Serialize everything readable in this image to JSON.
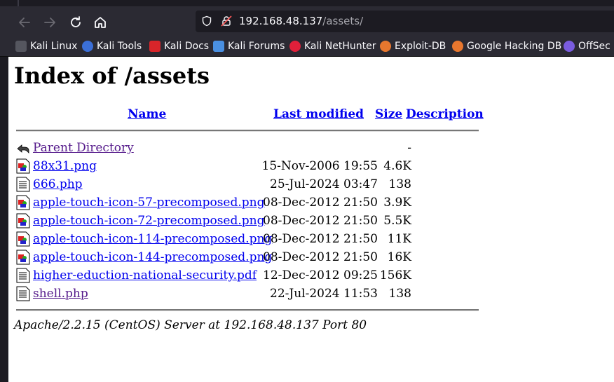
{
  "browser": {
    "url_host": "192.168.48.137",
    "url_path": "/assets/",
    "bookmarks": [
      {
        "label": "Kali Linux",
        "icon": "kali-dragon-icon",
        "color": "#dddddd"
      },
      {
        "label": "Kali Tools",
        "icon": "kali-tools-icon",
        "color": "#3b6fd8"
      },
      {
        "label": "Kali Docs",
        "icon": "kali-docs-icon",
        "color": "#d9252a"
      },
      {
        "label": "Kali Forums",
        "icon": "kali-forums-icon",
        "color": "#4a90e2"
      },
      {
        "label": "Kali NetHunter",
        "icon": "kali-nethunter-icon",
        "color": "#e0203a"
      },
      {
        "label": "Exploit-DB",
        "icon": "exploit-db-icon",
        "color": "#e8772e"
      },
      {
        "label": "Google Hacking DB",
        "icon": "ghdb-icon",
        "color": "#e8772e"
      },
      {
        "label": "OffSec",
        "icon": "offsec-icon",
        "color": "#7a5ce0"
      }
    ]
  },
  "page": {
    "title": "Index of /assets",
    "headers": {
      "name": "Name",
      "modified": "Last modified",
      "size": "Size",
      "description": "Description"
    },
    "files": [
      {
        "name": "Parent Directory",
        "date": "",
        "size": "-",
        "icon": "back-folder-icon",
        "visited": true
      },
      {
        "name": "88x31.png",
        "date": "15-Nov-2006 19:55",
        "size": "4.6K",
        "icon": "image-file-icon",
        "visited": false
      },
      {
        "name": "666.php",
        "date": "25-Jul-2024 03:47",
        "size": "138",
        "icon": "text-file-icon",
        "visited": false
      },
      {
        "name": "apple-touch-icon-57-precomposed.png",
        "date": "08-Dec-2012 21:50",
        "size": "3.9K",
        "icon": "image-file-icon",
        "visited": false
      },
      {
        "name": "apple-touch-icon-72-precomposed.png",
        "date": "08-Dec-2012 21:50",
        "size": "5.5K",
        "icon": "image-file-icon",
        "visited": false
      },
      {
        "name": "apple-touch-icon-114-precomposed.png",
        "date": "08-Dec-2012 21:50",
        "size": "11K",
        "icon": "image-file-icon",
        "visited": false
      },
      {
        "name": "apple-touch-icon-144-precomposed.png",
        "date": "08-Dec-2012 21:50",
        "size": "16K",
        "icon": "image-file-icon",
        "visited": false
      },
      {
        "name": "higher-eduction-national-security.pdf",
        "date": "12-Dec-2012 09:25",
        "size": "156K",
        "icon": "text-file-icon",
        "visited": false
      },
      {
        "name": "shell.php",
        "date": "22-Jul-2024 11:53",
        "size": "138",
        "icon": "text-file-icon",
        "visited": true
      }
    ],
    "footer": "Apache/2.2.15 (CentOS) Server at 192.168.48.137 Port 80"
  }
}
